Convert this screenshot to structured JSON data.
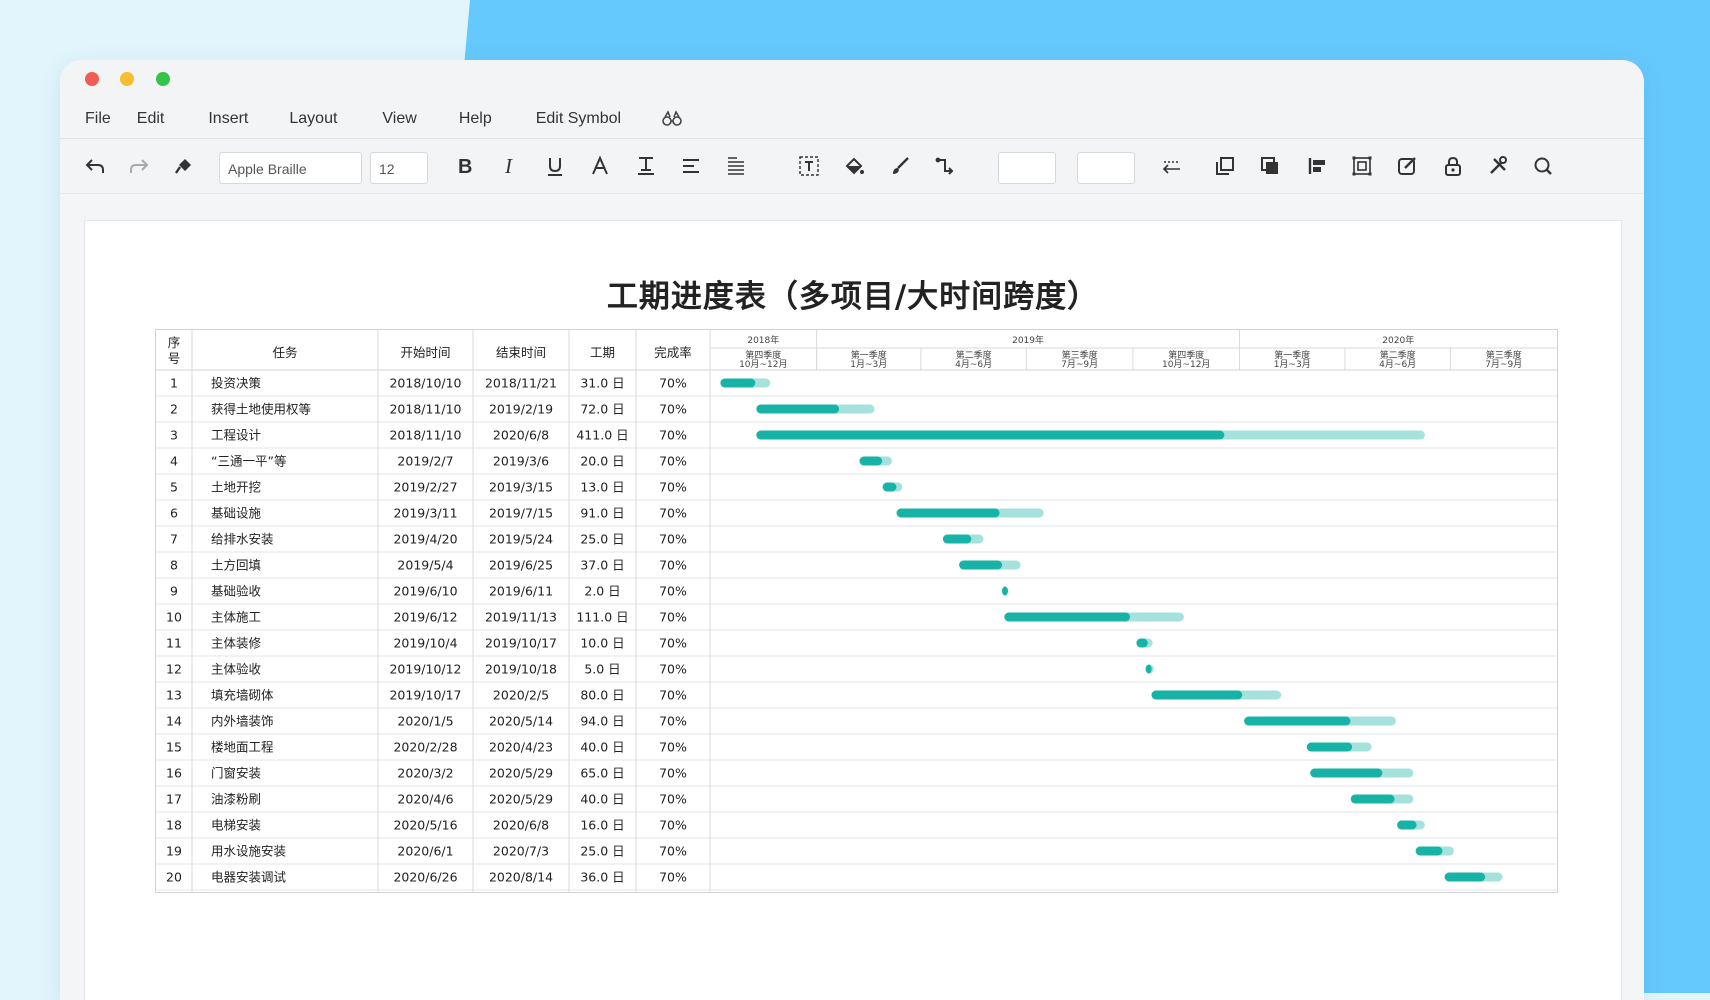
{
  "menu": [
    "File",
    "Edit",
    "Insert",
    "Layout",
    "View",
    "Help",
    "Edit Symbol"
  ],
  "toolbar": {
    "font_name": "Apple Braille",
    "font_size": "12",
    "icons": [
      "undo-icon",
      "redo-icon",
      "format-painter-icon",
      "bold-icon",
      "italic-icon",
      "underline-icon",
      "font-color-icon",
      "text-style-icon",
      "align-icon",
      "line-spacing-icon",
      "text-box-icon",
      "fill-icon",
      "brush-icon",
      "connector-icon",
      "arrow-style-icon",
      "bring-front-icon",
      "send-back-icon",
      "align-left-icon",
      "group-icon",
      "edit-shape-icon",
      "lock-icon",
      "tools-icon",
      "search-icon"
    ]
  },
  "colors": {
    "bar_done": "#17b3a6",
    "bar_remaining": "#a6e2dc",
    "accent_bg": "#66c9fd"
  },
  "chart_title": "工期进度表（多项目/大时间跨度）",
  "columns": {
    "seq": [
      "序",
      "号"
    ],
    "task": "任务",
    "start": "开始时间",
    "end": "结束时间",
    "duration": "工期",
    "rate": "完成率"
  },
  "timeline": {
    "years": [
      "2018年",
      "2019年",
      "2020年"
    ],
    "quarters": [
      {
        "q": "第四季度",
        "m": "10月~12月"
      },
      {
        "q": "第一季度",
        "m": "1月~3月"
      },
      {
        "q": "第二季度",
        "m": "4月~6月"
      },
      {
        "q": "第三季度",
        "m": "7月~9月"
      },
      {
        "q": "第四季度",
        "m": "10月~12月"
      },
      {
        "q": "第一季度",
        "m": "1月~3月"
      },
      {
        "q": "第二季度",
        "m": "4月~6月"
      },
      {
        "q": "第三季度",
        "m": "7月~9月"
      }
    ]
  },
  "chart_data": {
    "type": "gantt",
    "title": "工期进度表（多项目/大时间跨度）",
    "x_range": [
      "2018-10-01",
      "2020-09-30"
    ],
    "tasks": [
      {
        "id": "1",
        "name": "投资决策",
        "start": "2018/10/10",
        "end": "2018/11/21",
        "duration": "31.0 日",
        "rate": "70%",
        "progress": 0.7
      },
      {
        "id": "2",
        "name": "获得土地使用权等",
        "start": "2018/11/10",
        "end": "2019/2/19",
        "duration": "72.0 日",
        "rate": "70%",
        "progress": 0.7
      },
      {
        "id": "3",
        "name": "工程设计",
        "start": "2018/11/10",
        "end": "2020/6/8",
        "duration": "411.0 日",
        "rate": "70%",
        "progress": 0.7
      },
      {
        "id": "4",
        "name": "“三通一平”等",
        "start": "2019/2/7",
        "end": "2019/3/6",
        "duration": "20.0 日",
        "rate": "70%",
        "progress": 0.7
      },
      {
        "id": "5",
        "name": "土地开挖",
        "start": "2019/2/27",
        "end": "2019/3/15",
        "duration": "13.0 日",
        "rate": "70%",
        "progress": 0.7
      },
      {
        "id": "6",
        "name": "基础设施",
        "start": "2019/3/11",
        "end": "2019/7/15",
        "duration": "91.0 日",
        "rate": "70%",
        "progress": 0.7
      },
      {
        "id": "7",
        "name": "给排水安装",
        "start": "2019/4/20",
        "end": "2019/5/24",
        "duration": "25.0 日",
        "rate": "70%",
        "progress": 0.7
      },
      {
        "id": "8",
        "name": "土方回填",
        "start": "2019/5/4",
        "end": "2019/6/25",
        "duration": "37.0 日",
        "rate": "70%",
        "progress": 0.7
      },
      {
        "id": "9",
        "name": "基础验收",
        "start": "2019/6/10",
        "end": "2019/6/11",
        "duration": "2.0 日",
        "rate": "70%",
        "progress": 0.7
      },
      {
        "id": "10",
        "name": "主体施工",
        "start": "2019/6/12",
        "end": "2019/11/13",
        "duration": "111.0 日",
        "rate": "70%",
        "progress": 0.7
      },
      {
        "id": "11",
        "name": "主体装修",
        "start": "2019/10/4",
        "end": "2019/10/17",
        "duration": "10.0 日",
        "rate": "70%",
        "progress": 0.7
      },
      {
        "id": "12",
        "name": "主体验收",
        "start": "2019/10/12",
        "end": "2019/10/18",
        "duration": "5.0 日",
        "rate": "70%",
        "progress": 0.7
      },
      {
        "id": "13",
        "name": "填充墙砌体",
        "start": "2019/10/17",
        "end": "2020/2/5",
        "duration": "80.0 日",
        "rate": "70%",
        "progress": 0.7
      },
      {
        "id": "14",
        "name": "内外墙装饰",
        "start": "2020/1/5",
        "end": "2020/5/14",
        "duration": "94.0 日",
        "rate": "70%",
        "progress": 0.7
      },
      {
        "id": "15",
        "name": "楼地面工程",
        "start": "2020/2/28",
        "end": "2020/4/23",
        "duration": "40.0 日",
        "rate": "70%",
        "progress": 0.7
      },
      {
        "id": "16",
        "name": "门窗安装",
        "start": "2020/3/2",
        "end": "2020/5/29",
        "duration": "65.0 日",
        "rate": "70%",
        "progress": 0.7
      },
      {
        "id": "17",
        "name": "油漆粉刷",
        "start": "2020/4/6",
        "end": "2020/5/29",
        "duration": "40.0 日",
        "rate": "70%",
        "progress": 0.7
      },
      {
        "id": "18",
        "name": "电梯安装",
        "start": "2020/5/16",
        "end": "2020/6/8",
        "duration": "16.0 日",
        "rate": "70%",
        "progress": 0.7
      },
      {
        "id": "19",
        "name": "用水设施安装",
        "start": "2020/6/1",
        "end": "2020/7/3",
        "duration": "25.0 日",
        "rate": "70%",
        "progress": 0.7
      },
      {
        "id": "20",
        "name": "电器安装调试",
        "start": "2020/6/26",
        "end": "2020/8/14",
        "duration": "36.0 日",
        "rate": "70%",
        "progress": 0.7
      }
    ]
  }
}
